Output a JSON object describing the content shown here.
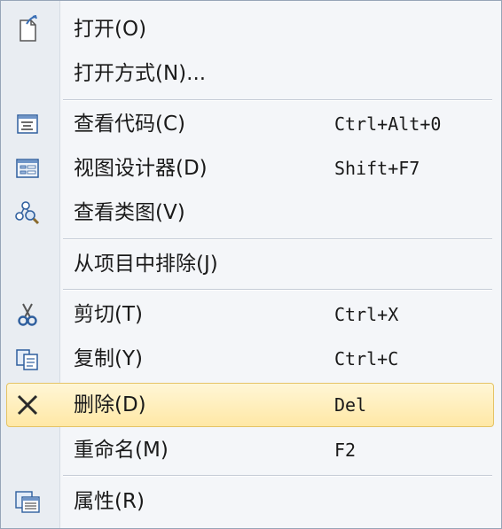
{
  "menu": {
    "items": [
      {
        "label": "打开(O)",
        "shortcut": "",
        "icon": "open-document-icon"
      },
      {
        "label": "打开方式(N)...",
        "shortcut": "",
        "icon": ""
      },
      {
        "label": "查看代码(C)",
        "shortcut": "Ctrl+Alt+0",
        "icon": "view-code-icon"
      },
      {
        "label": "视图设计器(D)",
        "shortcut": "Shift+F7",
        "icon": "view-designer-icon"
      },
      {
        "label": "查看类图(V)",
        "shortcut": "",
        "icon": "class-diagram-icon"
      },
      {
        "label": "从项目中排除(J)",
        "shortcut": "",
        "icon": ""
      },
      {
        "label": "剪切(T)",
        "shortcut": "Ctrl+X",
        "icon": "cut-icon"
      },
      {
        "label": "复制(Y)",
        "shortcut": "Ctrl+C",
        "icon": "copy-icon"
      },
      {
        "label": "删除(D)",
        "shortcut": "Del",
        "icon": "delete-icon"
      },
      {
        "label": "重命名(M)",
        "shortcut": "F2",
        "icon": "",
        "highlighted": false
      },
      {
        "label": "属性(R)",
        "shortcut": "",
        "icon": "properties-icon"
      }
    ],
    "highlighted_index": 8,
    "colors": {
      "highlight_border": "#e5c365",
      "highlight_fill": "#ffe8a6",
      "gutter": "#e9edf2",
      "background": "#f4f6f9"
    }
  }
}
